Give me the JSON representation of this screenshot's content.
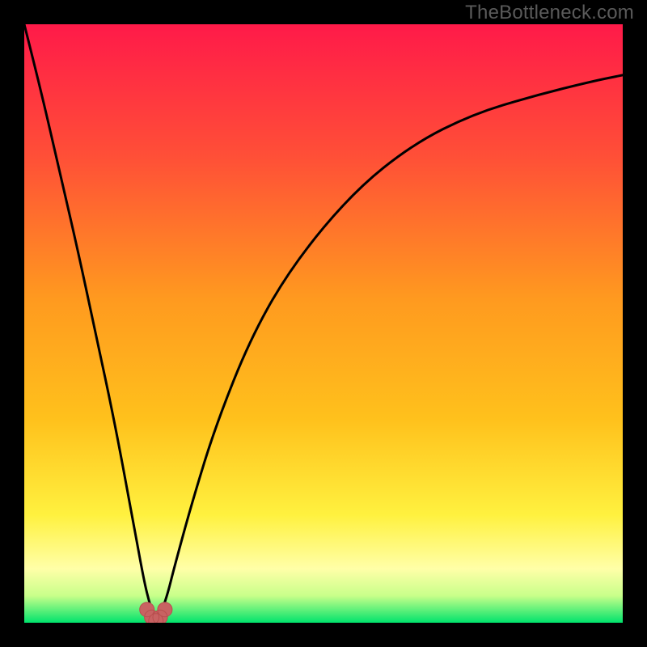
{
  "watermark": "TheBottleneck.com",
  "colors": {
    "bg_black": "#000000",
    "grad_top": "#ff1a49",
    "grad_mid_upper": "#ff6a2f",
    "grad_mid": "#ffc11c",
    "grad_mid_lower": "#ffe54a",
    "grad_light": "#ffffa8",
    "grad_green": "#00e36c",
    "curve": "#000000",
    "marker_fill": "#c86262",
    "marker_stroke": "#b84e4e"
  },
  "chart_data": {
    "type": "line",
    "title": "",
    "xlabel": "",
    "ylabel": "",
    "xlim": [
      0,
      100
    ],
    "ylim": [
      0,
      100
    ],
    "grid": false,
    "legend": false,
    "notes": "Background is a vertical red→orange→yellow→green gradient. Single black V-shaped curve with minimum near x≈22. A few red markers sit at the curve's bottom near y≈0.",
    "curve": {
      "x": [
        0,
        3,
        6,
        9,
        12,
        15,
        18,
        20,
        21,
        22,
        23,
        24,
        25,
        28,
        32,
        38,
        45,
        55,
        65,
        75,
        85,
        95,
        100
      ],
      "y": [
        100,
        88,
        75,
        62,
        48,
        34,
        18,
        7,
        3,
        0,
        2,
        5,
        9,
        20,
        33,
        48,
        60,
        72,
        80,
        85,
        88,
        90.5,
        91.5
      ]
    },
    "markers": {
      "x": [
        20.5,
        21.3,
        22,
        22.7,
        23.5
      ],
      "y": [
        2.2,
        0.9,
        0.3,
        0.9,
        2.2
      ]
    }
  }
}
